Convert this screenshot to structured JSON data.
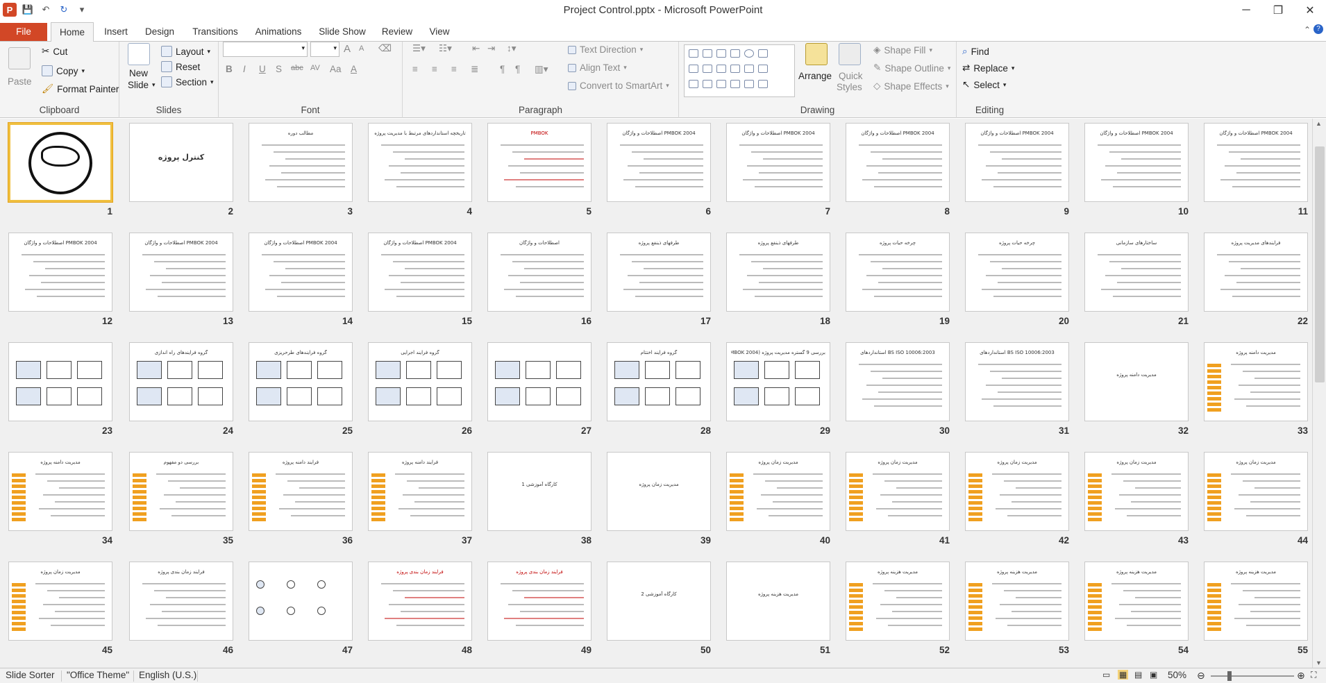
{
  "window": {
    "title": "Project Control.pptx  -  Microsoft PowerPoint"
  },
  "tabs": [
    "File",
    "Home",
    "Insert",
    "Design",
    "Transitions",
    "Animations",
    "Slide Show",
    "Review",
    "View"
  ],
  "ribbon": {
    "clipboard": {
      "label": "Clipboard",
      "paste": "Paste",
      "cut": "Cut",
      "copy": "Copy",
      "format_painter": "Format Painter"
    },
    "slides": {
      "label": "Slides",
      "new_slide_1": "New",
      "new_slide_2": "Slide",
      "layout": "Layout",
      "reset": "Reset",
      "section": "Section"
    },
    "font": {
      "label": "Font",
      "bold": "B",
      "italic": "I",
      "underline": "U",
      "shadow": "S",
      "strike": "abc",
      "spacing": "AV",
      "case": "Aa",
      "color": "A",
      "grow": "A",
      "shrink": "A"
    },
    "paragraph": {
      "label": "Paragraph",
      "text_direction": "Text Direction",
      "align_text": "Align Text",
      "convert_smartart": "Convert to SmartArt"
    },
    "drawing": {
      "label": "Drawing",
      "arrange": "Arrange",
      "quick_styles_1": "Quick",
      "quick_styles_2": "Styles",
      "shape_fill": "Shape Fill",
      "shape_outline": "Shape Outline",
      "shape_effects": "Shape Effects"
    },
    "editing": {
      "label": "Editing",
      "find": "Find",
      "replace": "Replace",
      "select": "Select"
    }
  },
  "slides": [
    {
      "n": "1",
      "t": "",
      "kind": "logo"
    },
    {
      "n": "2",
      "t": "کنترل پروژه",
      "kind": "title"
    },
    {
      "n": "3",
      "t": "مطالب دوره",
      "kind": "list"
    },
    {
      "n": "4",
      "t": "تاریخچه استانداردهای مرتبط با مدیریت پروژه",
      "kind": "list"
    },
    {
      "n": "5",
      "t": "PMBOK",
      "kind": "redlist"
    },
    {
      "n": "6",
      "t": "PMBOK 2004 اصطلاحات و واژگان",
      "kind": "list"
    },
    {
      "n": "7",
      "t": "PMBOK 2004 اصطلاحات و واژگان",
      "kind": "list"
    },
    {
      "n": "8",
      "t": "PMBOK 2004 اصطلاحات و واژگان",
      "kind": "list"
    },
    {
      "n": "9",
      "t": "PMBOK 2004 اصطلاحات و واژگان",
      "kind": "list"
    },
    {
      "n": "10",
      "t": "PMBOK 2004 اصطلاحات و واژگان",
      "kind": "list"
    },
    {
      "n": "11",
      "t": "PMBOK 2004 اصطلاحات و واژگان",
      "kind": "list"
    },
    {
      "n": "12",
      "t": "PMBOK 2004 اصطلاحات و واژگان",
      "kind": "list"
    },
    {
      "n": "13",
      "t": "PMBOK 2004 اصطلاحات و واژگان",
      "kind": "list"
    },
    {
      "n": "14",
      "t": "PMBOK 2004 اصطلاحات و واژگان",
      "kind": "list"
    },
    {
      "n": "15",
      "t": "PMBOK 2004 اصطلاحات و واژگان",
      "kind": "list"
    },
    {
      "n": "16",
      "t": "اصطلاحات و واژگان",
      "kind": "list"
    },
    {
      "n": "17",
      "t": "طرفهای ذینفع پروژه",
      "kind": "list"
    },
    {
      "n": "18",
      "t": "طرفهای ذینفع پروژه",
      "kind": "list"
    },
    {
      "n": "19",
      "t": "چرخه حیات پروژه",
      "kind": "list"
    },
    {
      "n": "20",
      "t": "چرخه حیات پروژه",
      "kind": "list"
    },
    {
      "n": "21",
      "t": "ساختارهای سازمانی",
      "kind": "list"
    },
    {
      "n": "22",
      "t": "فرایندهای مدیریت پروژه",
      "kind": "list"
    },
    {
      "n": "23",
      "t": "",
      "kind": "diagram"
    },
    {
      "n": "24",
      "t": "گروه فرایندهای راه اندازی",
      "kind": "diagram"
    },
    {
      "n": "25",
      "t": "گروه فرایندهای طرحریزی",
      "kind": "diagram"
    },
    {
      "n": "26",
      "t": "گروه فرایند اجرایی",
      "kind": "diagram"
    },
    {
      "n": "27",
      "t": "",
      "kind": "diagram"
    },
    {
      "n": "28",
      "t": "گروه فرایند اختتام",
      "kind": "diagram"
    },
    {
      "n": "29",
      "t": "بررسی 9 گستره مدیریت پروژه (PMBOK 2004)",
      "kind": "diagram"
    },
    {
      "n": "30",
      "t": "BS ISO 10006:2003 استانداردهای",
      "kind": "list"
    },
    {
      "n": "31",
      "t": "BS ISO 10006:2003 استانداردهای",
      "kind": "list"
    },
    {
      "n": "32",
      "t": "مدیریت دامنه پروژه",
      "kind": "center"
    },
    {
      "n": "33",
      "t": "مدیریت دامنه پروژه",
      "kind": "side"
    },
    {
      "n": "34",
      "t": "مدیریت دامنه پروژه",
      "kind": "side"
    },
    {
      "n": "35",
      "t": "بررسی دو مفهوم",
      "kind": "side"
    },
    {
      "n": "36",
      "t": "فرایند دامنه پروژه",
      "kind": "side"
    },
    {
      "n": "37",
      "t": "فرایند دامنه پروژه",
      "kind": "side"
    },
    {
      "n": "38",
      "t": "کارگاه آموزشی 1",
      "kind": "center"
    },
    {
      "n": "39",
      "t": "مدیریت زمان پروژه",
      "kind": "center"
    },
    {
      "n": "40",
      "t": "مدیریت زمان پروژه",
      "kind": "side"
    },
    {
      "n": "41",
      "t": "مدیریت زمان پروژه",
      "kind": "side"
    },
    {
      "n": "42",
      "t": "مدیریت زمان پروژه",
      "kind": "side"
    },
    {
      "n": "43",
      "t": "مدیریت زمان پروژه",
      "kind": "side"
    },
    {
      "n": "44",
      "t": "مدیریت زمان پروژه",
      "kind": "side"
    },
    {
      "n": "45",
      "t": "مدیریت زمان پروژه",
      "kind": "side"
    },
    {
      "n": "46",
      "t": "فرایند زمان بندی پروژه",
      "kind": "list"
    },
    {
      "n": "47",
      "t": "",
      "kind": "network"
    },
    {
      "n": "48",
      "t": "فرایند زمان بندی پروژه",
      "kind": "redlist"
    },
    {
      "n": "49",
      "t": "فرایند زمان بندی پروژه",
      "kind": "redlist"
    },
    {
      "n": "50",
      "t": "کارگاه آموزشی 2",
      "kind": "center"
    },
    {
      "n": "51",
      "t": "مدیریت هزینه پروژه",
      "kind": "center"
    },
    {
      "n": "52",
      "t": "مدیریت هزینه پروژه",
      "kind": "side"
    },
    {
      "n": "53",
      "t": "مدیریت هزینه پروژه",
      "kind": "side"
    },
    {
      "n": "54",
      "t": "مدیریت هزینه پروژه",
      "kind": "side"
    },
    {
      "n": "55",
      "t": "مدیریت هزینه پروژه",
      "kind": "side"
    }
  ],
  "status": {
    "view": "Slide Sorter",
    "theme": "\"Office Theme\"",
    "language": "English (U.S.)",
    "zoom": "50%"
  }
}
